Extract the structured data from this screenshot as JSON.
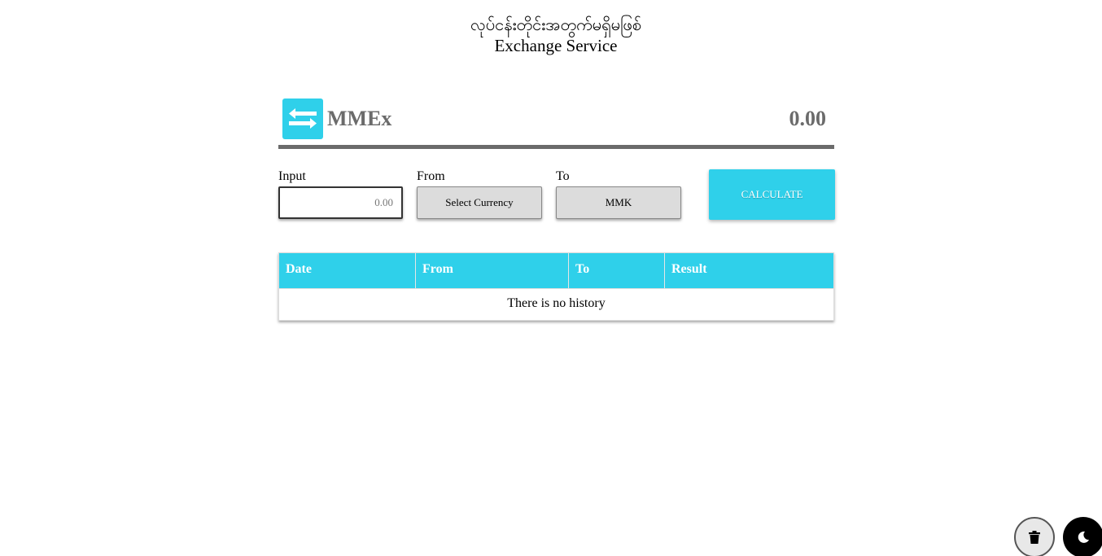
{
  "header": {
    "title_mm": "လုပ်ငန်းတိုင်းအတွက်မရှိမဖြစ်",
    "title_en": "Exchange Service"
  },
  "app_bar": {
    "brand": "MMEx",
    "total": "0.00",
    "logo_icon": "swap-arrows-icon"
  },
  "form": {
    "input_label": "Input",
    "input_placeholder": "0.00",
    "input_value": "",
    "from_label": "From",
    "from_selected": "Select Currency",
    "to_label": "To",
    "to_selected": "MMK",
    "calculate_label": "CALCULATE"
  },
  "history": {
    "columns": [
      "Date",
      "From",
      "To",
      "Result"
    ],
    "empty_message": "There is no history"
  },
  "fabs": {
    "clear_icon": "trash-icon",
    "theme_icon": "moon-icon"
  },
  "colors": {
    "accent": "#2fd0ea",
    "brand_text": "#6b6b6b",
    "select_bg": "#dcdcdc"
  }
}
